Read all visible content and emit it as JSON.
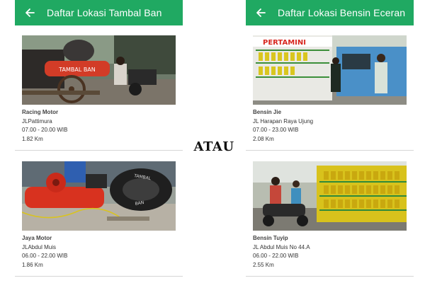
{
  "left_panel": {
    "title": "Daftar Lokasi Tambal Ban",
    "back_icon": "arrow-left-icon",
    "items": [
      {
        "name": "Racing Motor",
        "address": "JLPattimura",
        "hours": "07.00 - 20.00 WIB",
        "distance": "1.82 Km",
        "photo_sign": "TAMBAL BAN"
      },
      {
        "name": "Jaya Motor",
        "address": "JLAbdul Muis",
        "hours": "06.00 - 22.00 WIB",
        "distance": "1.86 Km",
        "photo_sign": "TAMBAL BAN"
      }
    ]
  },
  "right_panel": {
    "title": "Daftar Lokasi Bensin Eceran",
    "back_icon": "arrow-left-icon",
    "items": [
      {
        "name": "Bensin Jie",
        "address": "JL Harapan Raya Ujung",
        "hours": "07.00 - 23.00 WIB",
        "distance": "2.08 Km",
        "photo_sign": "PERTAMINI"
      },
      {
        "name": "Bensin Tuyip",
        "address": "JL Abdul Muis No 44.A",
        "hours": "06.00 - 22.00 WIB",
        "distance": "2.55 Km"
      }
    ]
  },
  "separator_text": "ATAU",
  "colors": {
    "appbar": "#20a962",
    "appbar_text": "#ffffff",
    "divider": "#d6d6d6"
  }
}
